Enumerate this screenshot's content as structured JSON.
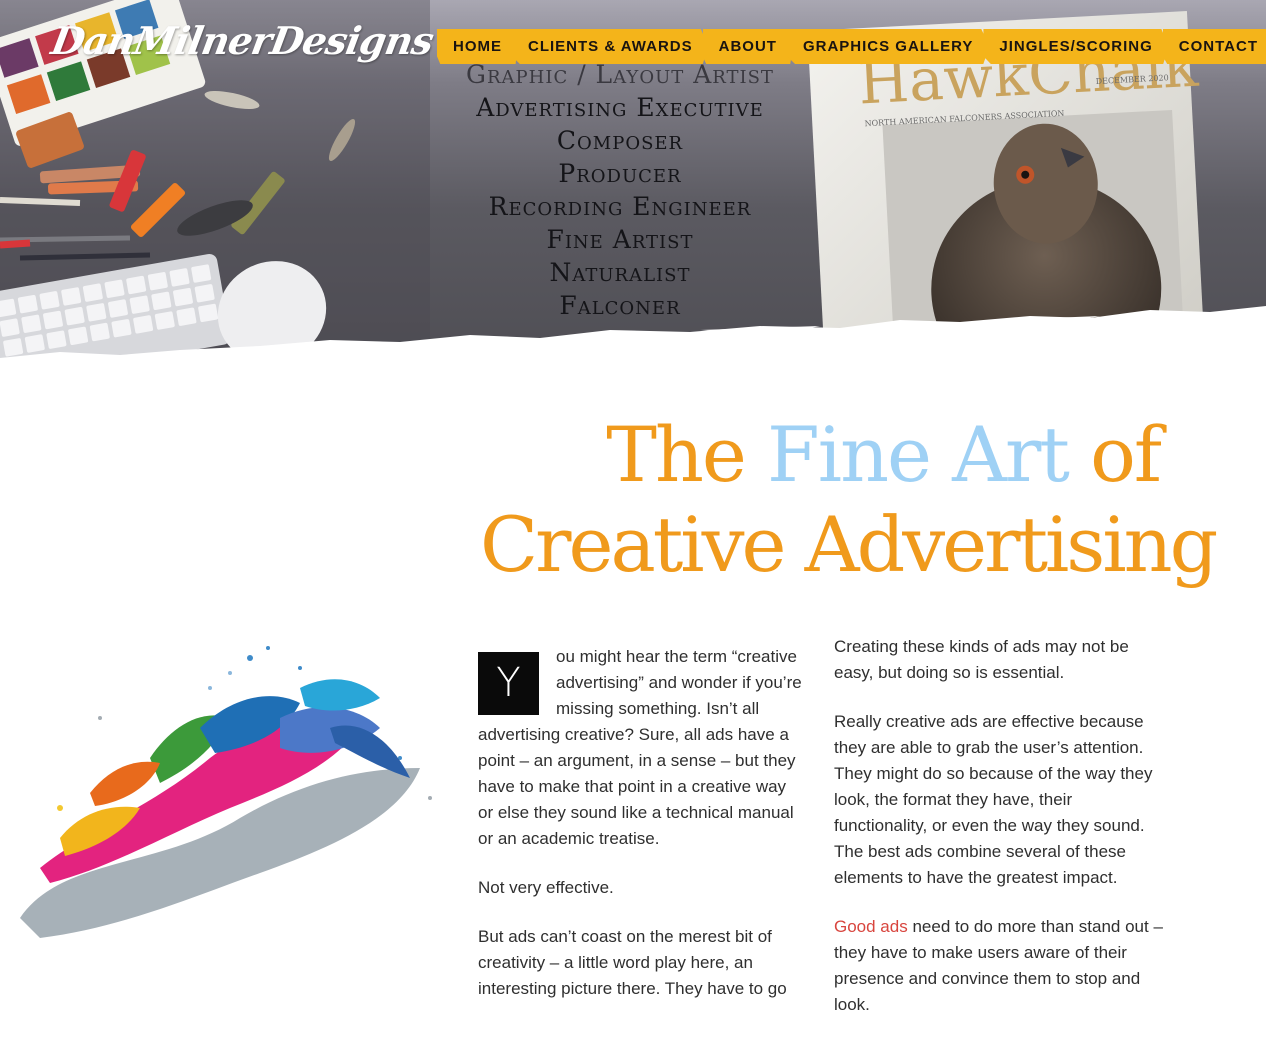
{
  "header": {
    "logo": "DanMilnerDesigns",
    "magazine_title": "HawkChalk",
    "magazine_org": "NORTH AMERICAN FALCONERS ASSOCIATION",
    "magazine_date": "DECEMBER 2020"
  },
  "nav": {
    "items": [
      {
        "label": "HOME"
      },
      {
        "label": "CLIENTS & AWARDS"
      },
      {
        "label": "ABOUT"
      },
      {
        "label": "GRAPHICS GALLERY"
      },
      {
        "label": "JINGLES/SCORING"
      },
      {
        "label": "CONTACT"
      }
    ]
  },
  "roles": [
    "Graphic / Layout Artist",
    "Advertising Executive",
    "Composer",
    "Producer",
    "Recording Engineer",
    "Fine Artist",
    "Naturalist",
    "Falconer"
  ],
  "title": {
    "part1": "The",
    "accent": "Fine Art",
    "part2": "of",
    "line2": "Creative Advertising"
  },
  "article": {
    "dropcap": "Y",
    "left": {
      "p1": "ou might hear the term “creative advertising” and wonder if you’re missing something. Isn’t all advertising creative? Sure, all ads have a point – an argument, in a sense – but they have to make that point in a creative way or else they sound like a technical manual or an academic treatise.",
      "p2": "Not very effective.",
      "p3": "But ads can’t coast on the merest bit of creativity – a little word play here, an interesting picture there. They have to go"
    },
    "right": {
      "p1": "Creating these kinds of ads may not be easy, but doing so is essential.",
      "p2": "Really creative ads are effective because they are able to grab the user’s attention. They might do so because of the way they look, the format they have, their functionality, or even the way they sound. The best ads combine several of these elements to have the greatest impact.",
      "p3_link": "Good ads",
      "p3_rest": " need to do more than stand out – they have to make users aware of their presence and convince them to stop and look."
    }
  },
  "colors": {
    "nav_bg": "#f4b41a",
    "title_orange": "#f09a1c",
    "title_blue": "#9fd1f5",
    "link_red": "#d8453e",
    "dropcap_bg": "#0a0a0a"
  }
}
